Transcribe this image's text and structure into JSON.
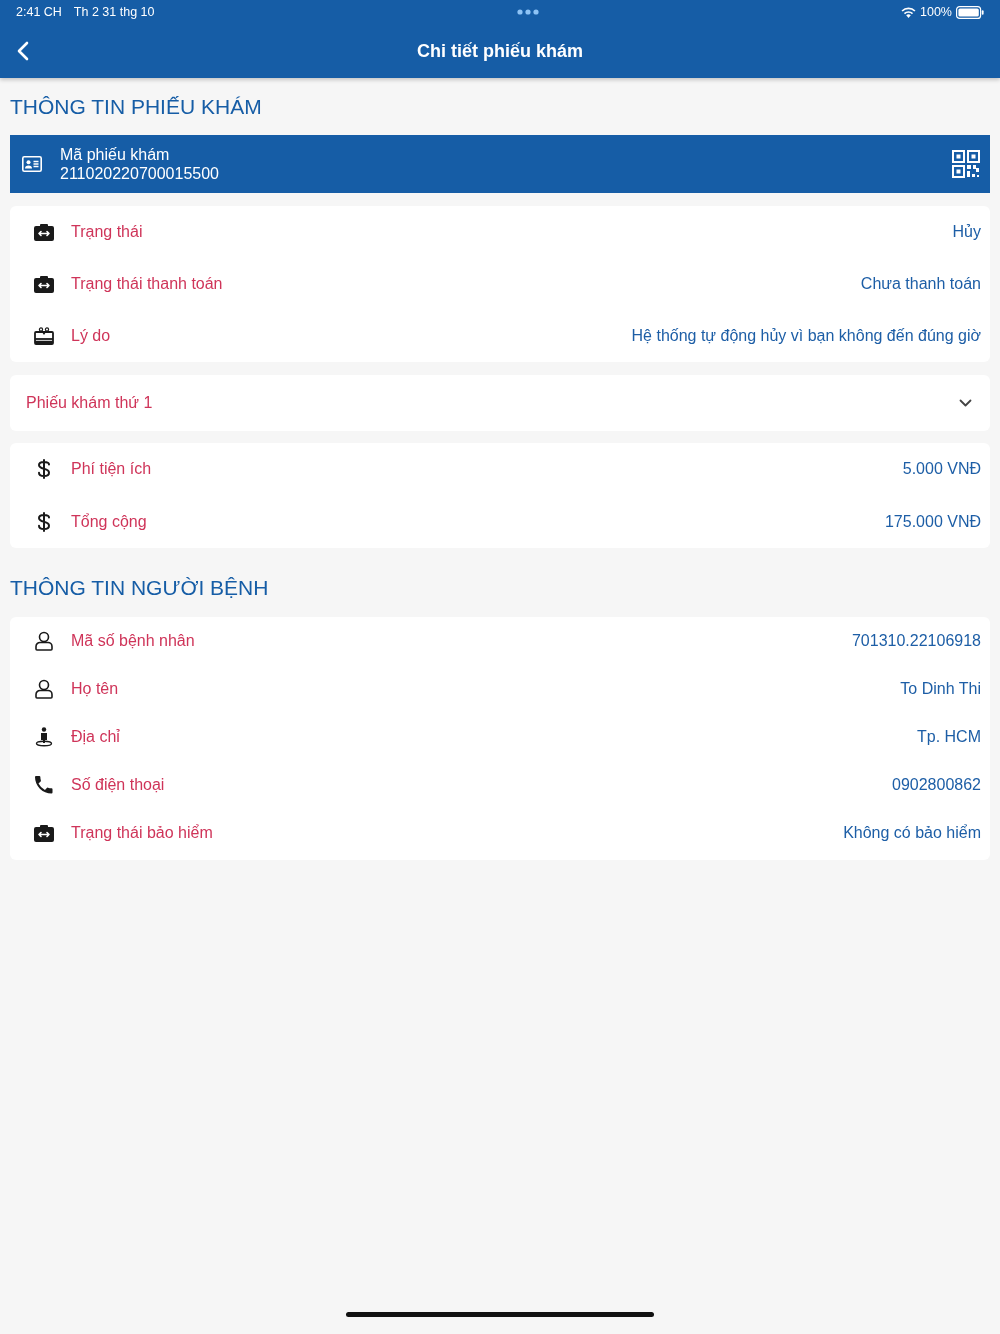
{
  "status_bar": {
    "time": "2:41 CH",
    "date": "Th 2 31 thg 10",
    "battery": "100%"
  },
  "header": {
    "title": "Chi tiết phiếu khám"
  },
  "exam_section": {
    "title": "THÔNG TIN PHIẾU KHÁM",
    "ticket": {
      "label": "Mã phiếu khám",
      "value": "211020220700015500"
    },
    "status_rows": [
      {
        "kind": "briefcase",
        "label": "Trạng thái",
        "value": "Hủy"
      },
      {
        "kind": "briefcase",
        "label": "Trạng thái thanh toán",
        "value": "Chưa thanh toán"
      },
      {
        "kind": "cake",
        "label": "Lý do",
        "value": "Hệ thống tự động hủy vì bạn không đến đúng giờ"
      }
    ],
    "ticket_dropdown": {
      "label": "Phiếu khám thứ 1",
      "expanded": false
    },
    "fee_rows": [
      {
        "kind": "dollar",
        "label": "Phí tiện ích",
        "value": "5.000 VNĐ"
      },
      {
        "kind": "dollar",
        "label": "Tổng cộng",
        "value": "175.000 VNĐ"
      }
    ]
  },
  "patient_section": {
    "title": "THÔNG TIN NGƯỜI BỆNH",
    "rows": [
      {
        "kind": "user",
        "label": "Mã số bệnh nhân",
        "value": "701310.22106918"
      },
      {
        "kind": "user",
        "label": "Họ tên",
        "value": "To Dinh Thi"
      },
      {
        "kind": "pin",
        "label": "Địa chỉ",
        "value": "Tp. HCM"
      },
      {
        "kind": "phone",
        "label": "Số điện thoại",
        "value": "0902800862"
      },
      {
        "kind": "briefcase",
        "label": "Trạng thái bảo hiểm",
        "value": "Không có bảo hiểm"
      }
    ]
  }
}
